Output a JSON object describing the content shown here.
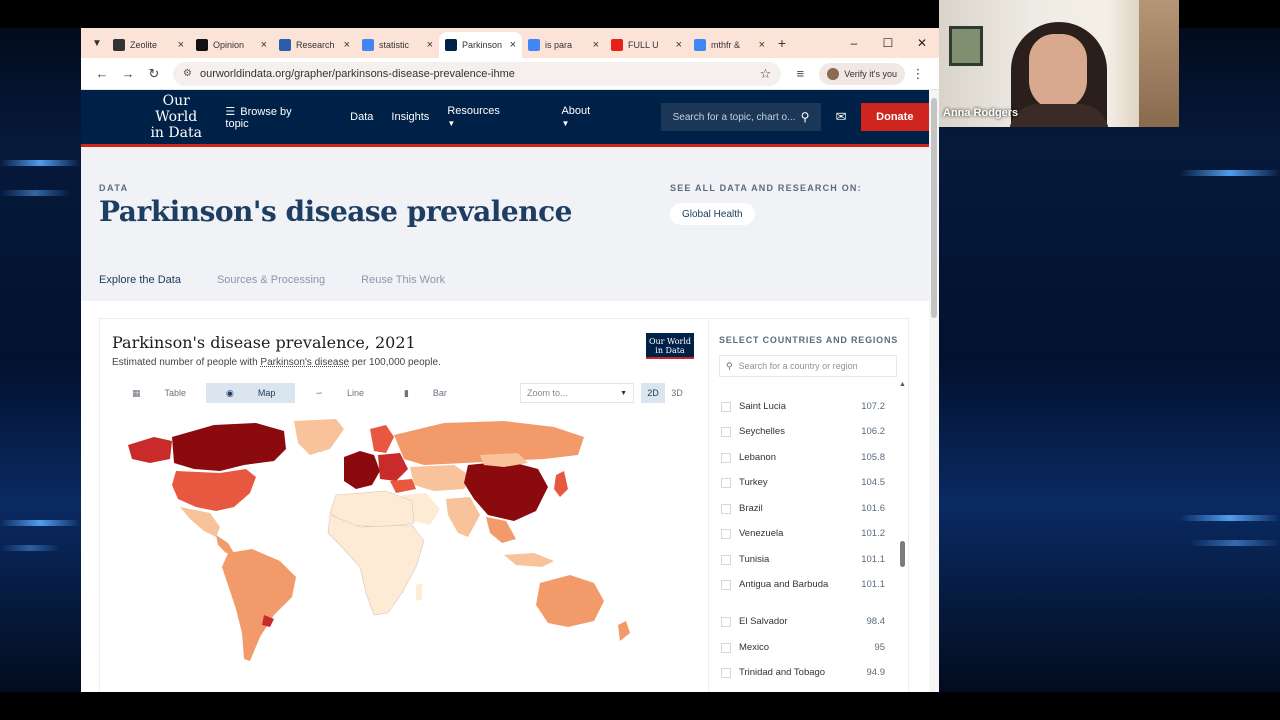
{
  "browser": {
    "tabs": [
      {
        "title": "Zeolite",
        "favicon": "ai-icon",
        "color": "#333"
      },
      {
        "title": "Opinion",
        "favicon": "nyt-icon",
        "color": "#111"
      },
      {
        "title": "Research",
        "favicon": "u-icon",
        "color": "#2a5db0"
      },
      {
        "title": "statistic",
        "favicon": "google-icon",
        "color": "#4285f4"
      },
      {
        "title": "Parkinson",
        "favicon": "owid-icon",
        "color": "#002147"
      },
      {
        "title": "is para",
        "favicon": "google-icon",
        "color": "#4285f4"
      },
      {
        "title": "FULL U",
        "favicon": "youtube-icon",
        "color": "#e62117"
      },
      {
        "title": "mthfr &",
        "favicon": "google-icon",
        "color": "#4285f4"
      }
    ],
    "url": "ourworldindata.org/grapher/parkinsons-disease-prevalence-ihme",
    "verify_label": "Verify it's you"
  },
  "site": {
    "logo_line1": "Our World",
    "logo_line2": "in Data",
    "nav": [
      "Browse by topic",
      "Data",
      "Insights",
      "Resources",
      "About"
    ],
    "search_placeholder": "Search for a topic, chart o...",
    "donate": "Donate"
  },
  "hero": {
    "label": "DATA",
    "title": "Parkinson's disease prevalence",
    "see_all": "SEE ALL DATA AND RESEARCH ON:",
    "topic_pill": "Global Health",
    "subtabs": [
      "Explore the Data",
      "Sources & Processing",
      "Reuse This Work"
    ]
  },
  "chart": {
    "title": "Parkinson's disease prevalence, 2021",
    "subtitle_pre": "Estimated number of people with ",
    "subtitle_link": "Parkinson's disease",
    "subtitle_post": " per 100,000 people.",
    "logo_line1": "Our World",
    "logo_line2": "in Data",
    "view_tabs": [
      "Table",
      "Map",
      "Line",
      "Bar"
    ],
    "zoom_placeholder": "Zoom to...",
    "dims": [
      "2D",
      "3D"
    ]
  },
  "countries": {
    "heading": "SELECT COUNTRIES AND REGIONS",
    "search_placeholder": "Search for a country or region",
    "rows": [
      {
        "name": "Saint Lucia",
        "value": "107.2"
      },
      {
        "name": "Seychelles",
        "value": "106.2"
      },
      {
        "name": "Lebanon",
        "value": "105.8"
      },
      {
        "name": "Turkey",
        "value": "104.5"
      },
      {
        "name": "Brazil",
        "value": "101.6"
      },
      {
        "name": "Venezuela",
        "value": "101.2"
      },
      {
        "name": "Tunisia",
        "value": "101.1"
      },
      {
        "name": "Antigua and Barbuda",
        "value": "101.1"
      },
      {
        "name": "El Salvador",
        "value": "98.4"
      },
      {
        "name": "Mexico",
        "value": "95"
      },
      {
        "name": "Trinidad and Tobago",
        "value": "94.9"
      }
    ]
  },
  "webcam": {
    "name": "Anna Rodgers"
  },
  "colors": {
    "owid_navy": "#002147",
    "donate_red": "#ce261e",
    "map_darkest": "#8b0a0e",
    "map_dark": "#c92a2a",
    "map_mid": "#e8573f",
    "map_light": "#f39a6b",
    "map_lighter": "#f8c39a",
    "map_lightest": "#fdebd6"
  }
}
